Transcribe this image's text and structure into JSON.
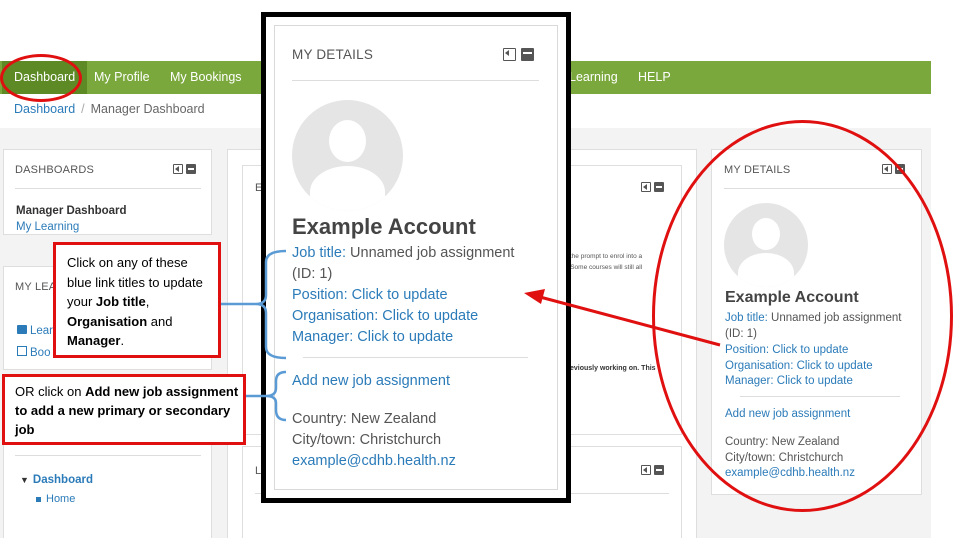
{
  "nav": {
    "items": [
      "Dashboard",
      "My Profile",
      "My Bookings",
      "Learning",
      "HELP"
    ]
  },
  "breadcrumb": {
    "root": "Dashboard",
    "current": "Manager Dashboard"
  },
  "dashboards_block": {
    "title": "DASHBOARDS",
    "item_active": "Manager Dashboard",
    "item_link": "My Learning"
  },
  "learning_block": {
    "title_partial": "MY LEA",
    "item1_partial": "Lear",
    "item2_partial": "Boo"
  },
  "nav_block": {
    "dashboard": "Dashboard",
    "home": "Home"
  },
  "middle_block": {
    "title_partial": "E",
    "text_line1": "ct the prompt to enrol into a",
    "text_line2": "e. Some courses will still all",
    "text_line3": "previously working on. This",
    "title_partial2": "L"
  },
  "details": {
    "title": "MY DETAILS",
    "name": "Example Account",
    "job_title_label": "Job title:",
    "job_title_value": "Unnamed job assignment",
    "job_id": "(ID: 1)",
    "position": "Position: Click to update",
    "organisation": "Organisation: Click to update",
    "manager": "Manager: Click to update",
    "add_job": "Add new job assignment",
    "country": "Country: New Zealand",
    "city": "City/town: Christchurch",
    "email": "example@cdhb.health.nz"
  },
  "annotations": {
    "note1_pre": "Click on any of these blue link titles to update your ",
    "note1_b1": "Job title",
    "note1_mid1": ", ",
    "note1_b2": "Organisation",
    "note1_mid2": " and ",
    "note1_b3": "Manager",
    "note1_end": ".",
    "note2_pre": "OR click on ",
    "note2_bold": "Add new job assignment to add a new primary or secondary job"
  },
  "colors": {
    "nav_green": "#7aa83c",
    "nav_active": "#5d8a24",
    "link_blue": "#2b7bb9",
    "annotation_red": "#e01010",
    "bracket_blue": "#5b9bd5"
  }
}
